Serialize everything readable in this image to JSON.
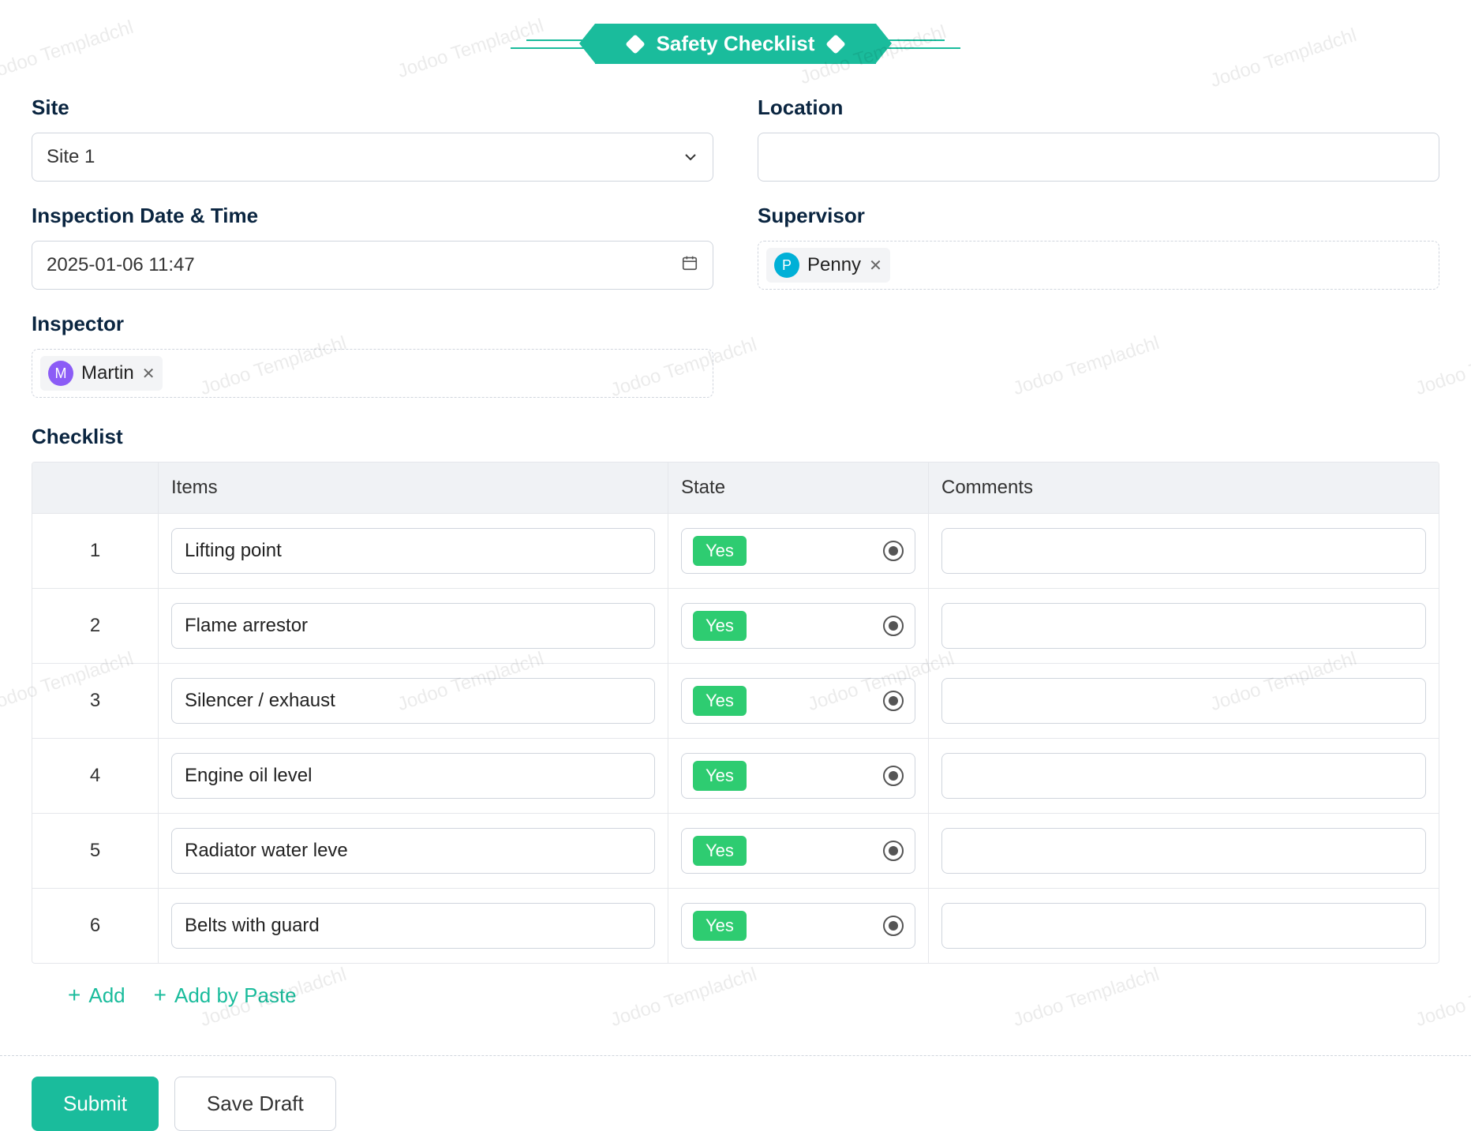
{
  "watermark_text": "Jodoo Templadchl",
  "header_title": "Safety Checklist",
  "fields": {
    "site_label": "Site",
    "site_value": "Site 1",
    "location_label": "Location",
    "location_value": "",
    "inspection_label": "Inspection Date & Time",
    "inspection_value": "2025-01-06 11:47",
    "supervisor_label": "Supervisor",
    "supervisor_initial": "P",
    "supervisor_name": "Penny",
    "inspector_label": "Inspector",
    "inspector_initial": "M",
    "inspector_name": "Martin"
  },
  "checklist": {
    "label": "Checklist",
    "headers": [
      "",
      "Items",
      "State",
      "Comments"
    ],
    "rows": [
      {
        "num": "1",
        "item": "Lifting point",
        "state": "Yes",
        "comment": ""
      },
      {
        "num": "2",
        "item": "Flame arrestor",
        "state": "Yes",
        "comment": ""
      },
      {
        "num": "3",
        "item": "Silencer / exhaust",
        "state": "Yes",
        "comment": ""
      },
      {
        "num": "4",
        "item": "Engine oil level",
        "state": "Yes",
        "comment": ""
      },
      {
        "num": "5",
        "item": "Radiator water leve",
        "state": "Yes",
        "comment": ""
      },
      {
        "num": "6",
        "item": "Belts with guard",
        "state": "Yes",
        "comment": ""
      }
    ],
    "add_label": "Add",
    "add_paste_label": "Add by Paste"
  },
  "footer": {
    "submit_label": "Submit",
    "save_draft_label": "Save Draft"
  }
}
